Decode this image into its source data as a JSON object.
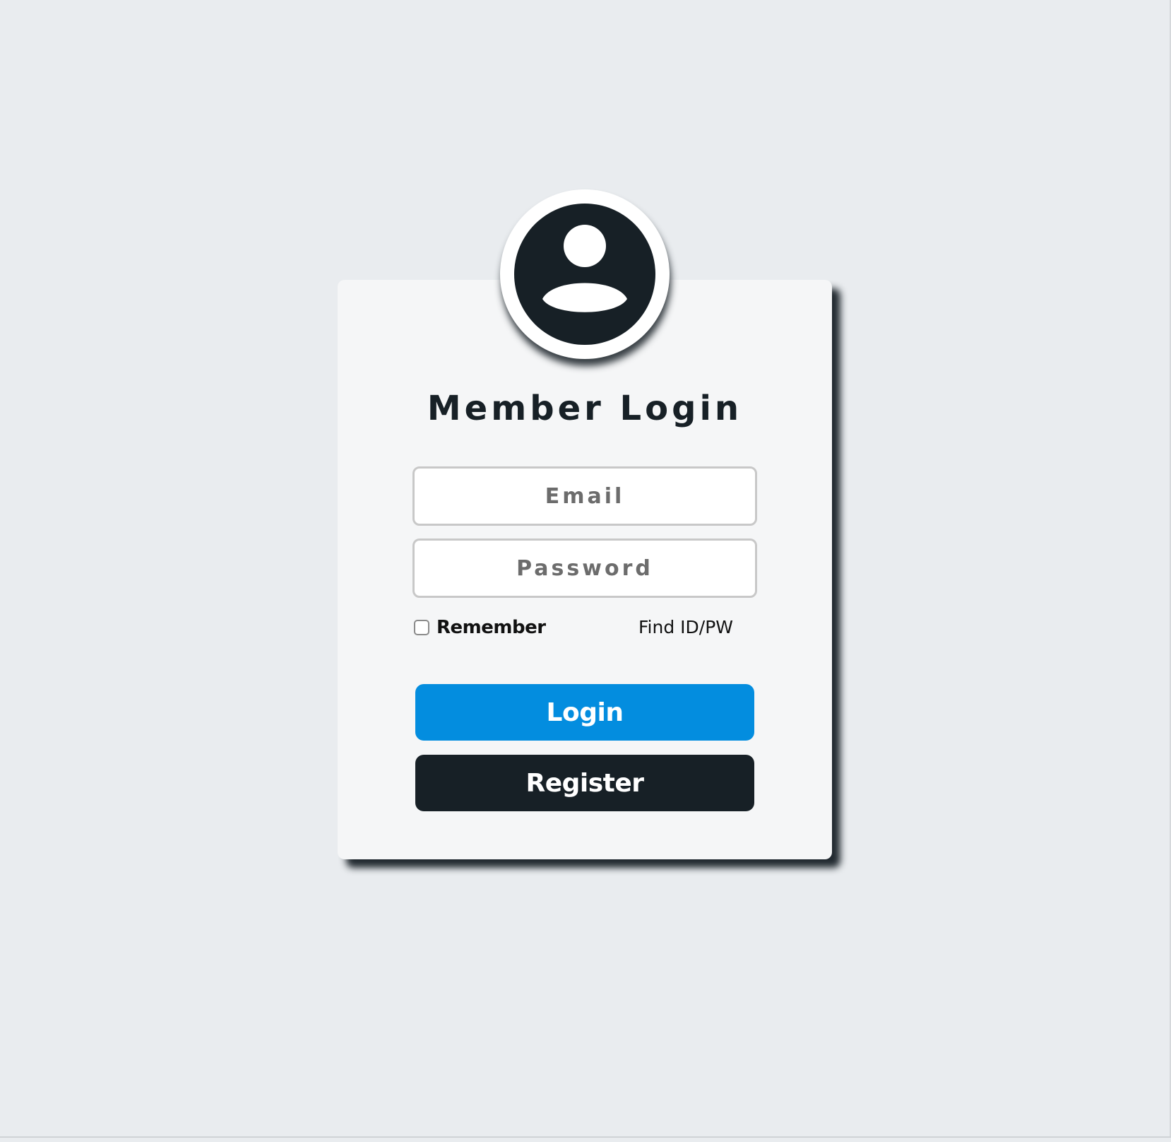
{
  "login_form": {
    "title": "Member Login",
    "avatar_icon": "user-circle-icon",
    "email": {
      "placeholder": "Email",
      "value": ""
    },
    "password": {
      "placeholder": "Password",
      "value": ""
    },
    "remember": {
      "label": "Remember",
      "checked": false
    },
    "find_link": "Find ID/PW",
    "login_button": "Login",
    "register_button": "Register"
  },
  "colors": {
    "background": "#e9ecef",
    "card": "#f5f6f7",
    "dark": "#172026",
    "login_button": "#038ddf",
    "register_button": "#172026"
  }
}
